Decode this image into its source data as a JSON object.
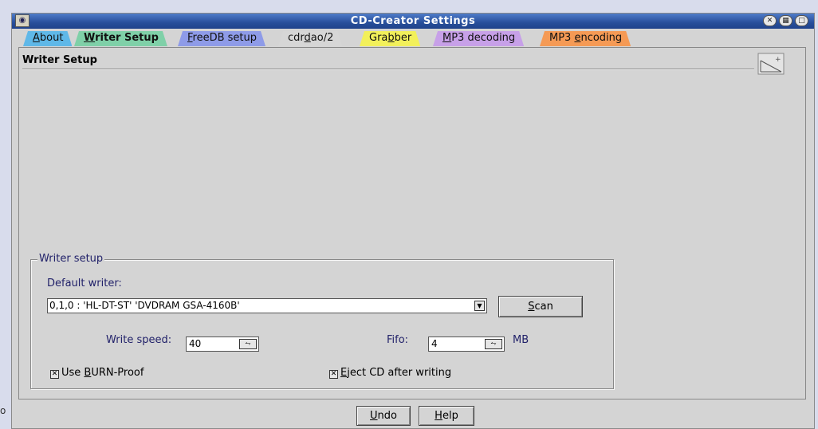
{
  "window": {
    "title": "CD-Creator Settings",
    "app_icon": "cd-creator-icon",
    "controls": [
      "close-icon",
      "maximize-icon",
      "minimize-icon"
    ]
  },
  "tabs": [
    {
      "label_pre": "",
      "label_u": "A",
      "label_post": "bout",
      "color": "#5fb8e8",
      "active": false
    },
    {
      "label_pre": "",
      "label_u": "W",
      "label_post": "riter Setup",
      "color": "#7fd0a8",
      "active": true
    },
    {
      "label_pre": "",
      "label_u": "F",
      "label_post": "reeDB setup",
      "color": "#8e9be8",
      "active": false
    },
    {
      "label_pre": "cdr",
      "label_u": "d",
      "label_post": "ao/2",
      "color": "#d6d6d6",
      "active": false
    },
    {
      "label_pre": "Gra",
      "label_u": "b",
      "label_post": "ber",
      "color": "#f2f05a",
      "active": false
    },
    {
      "label_pre": "",
      "label_u": "M",
      "label_post": "P3 decoding",
      "color": "#c7a0e8",
      "active": false
    },
    {
      "label_pre": "MP3 ",
      "label_u": "e",
      "label_post": "ncoding",
      "color": "#f59a55",
      "active": false
    }
  ],
  "page": {
    "title": "Writer Setup"
  },
  "writer_group": {
    "legend": "Writer setup",
    "default_writer_label": "Default writer:",
    "default_writer_value": "0,1,0 : 'HL-DT-ST' 'DVDRAM GSA-4160B'",
    "scan_pre": "",
    "scan_u": "S",
    "scan_post": "can",
    "write_speed_label": "Write speed:",
    "write_speed_value": "40",
    "fifo_label": "Fifo:",
    "fifo_value": "4",
    "fifo_unit": "MB",
    "burn_proof_pre": "Use ",
    "burn_proof_u": "B",
    "burn_proof_post": "URN-Proof",
    "burn_proof_checked": true,
    "eject_pre": "",
    "eject_u": "E",
    "eject_post": "ject CD after writing",
    "eject_checked": true
  },
  "buttons": {
    "undo_u": "U",
    "undo_post": "ndo",
    "help_u": "H",
    "help_post": "elp"
  },
  "stray_char": "o"
}
